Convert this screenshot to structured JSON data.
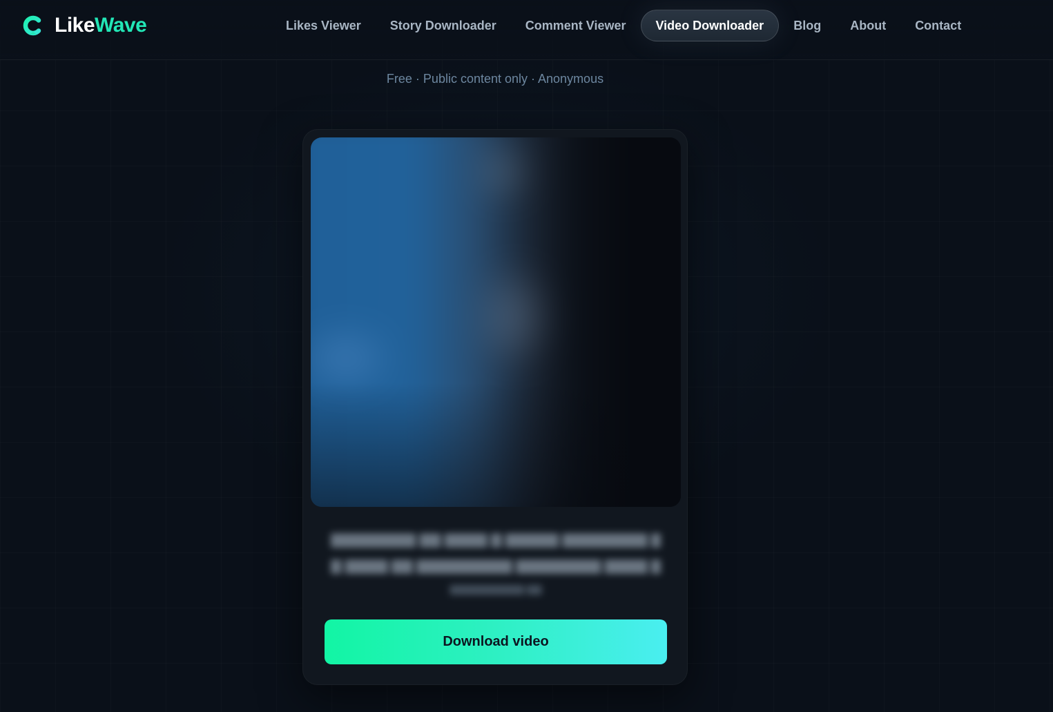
{
  "brand": {
    "name_part1": "Like",
    "name_part2": "Wave",
    "accent_color": "#22e6b6",
    "logo_icon": "brand-c-logo"
  },
  "nav": {
    "items": [
      {
        "label": "Likes Viewer",
        "active": false
      },
      {
        "label": "Story Downloader",
        "active": false
      },
      {
        "label": "Comment Viewer",
        "active": false
      },
      {
        "label": "Video Downloader",
        "active": true
      },
      {
        "label": "Blog",
        "active": false
      },
      {
        "label": "About",
        "active": false
      },
      {
        "label": "Contact",
        "active": false
      }
    ]
  },
  "tagline": "Free · Public content only · Anonymous",
  "card": {
    "preview": {
      "state": "blurred"
    },
    "caption": {
      "state": "blurred"
    },
    "download_label": "Download video",
    "button_gradient": [
      "#12f5a4",
      "#4aeef0"
    ]
  }
}
